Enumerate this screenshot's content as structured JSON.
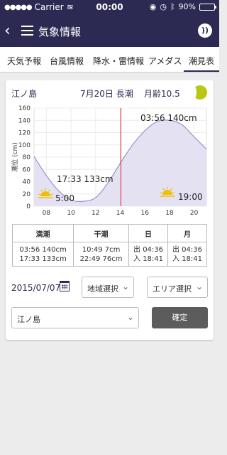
{
  "status": {
    "carrier": "Carrier",
    "time": "00:00",
    "battery": "90%",
    "battery_level": 0.9
  },
  "nav": {
    "title": "気象情報",
    "back_icon": "chevron-left-icon",
    "menu_icon": "hamburger-icon",
    "feed_icon": "rss-icon"
  },
  "tabs": [
    {
      "label": "天気予報"
    },
    {
      "label": "台風情報"
    },
    {
      "label": "降水・雷情報"
    },
    {
      "label": "アメダス"
    },
    {
      "label": "潮見表",
      "active": true
    }
  ],
  "card": {
    "place": "江ノ島",
    "date": "7月20日",
    "tide_type": "長潮",
    "moon_age": "月齢10.5"
  },
  "chart_data": {
    "type": "area",
    "ylabel": "潮位 (cm)",
    "ylim": [
      0,
      160
    ],
    "yticks": [
      0,
      20,
      40,
      60,
      80,
      100,
      120,
      140,
      160
    ],
    "xlim": [
      7,
      21
    ],
    "xticks": [
      "08",
      "10",
      "12",
      "14",
      "16",
      "18",
      "20"
    ],
    "x": [
      7,
      8,
      9,
      10,
      11,
      12,
      13,
      14,
      15,
      16,
      17,
      18,
      19,
      20,
      21
    ],
    "values": [
      81,
      50,
      25,
      10,
      8,
      14,
      38,
      70,
      100,
      123,
      138,
      140,
      133,
      113,
      93
    ],
    "current_hour": 14.05,
    "annotations": [
      {
        "text": "03:56 140cm"
      },
      {
        "text": "17:33 133cm"
      }
    ],
    "sunrise": "5:00",
    "sunset": "19:00",
    "fill_color": "#e4e1f2",
    "line_color": "#9a93cc",
    "now_color": "#e02020"
  },
  "table": {
    "headers": [
      "満潮",
      "干潮",
      "日",
      "月"
    ],
    "rows": [
      [
        "03:56 140cm",
        "10:49 7cm",
        "出 04:36",
        "出 04:36"
      ],
      [
        "17:33 133cm",
        "22:49 76cm",
        "入 18:41",
        "入 18:41"
      ]
    ]
  },
  "controls": {
    "date": "2015/07/07",
    "region": "地域選択",
    "area": "エリア選択",
    "location": "江ノ島",
    "confirm": "確定"
  }
}
